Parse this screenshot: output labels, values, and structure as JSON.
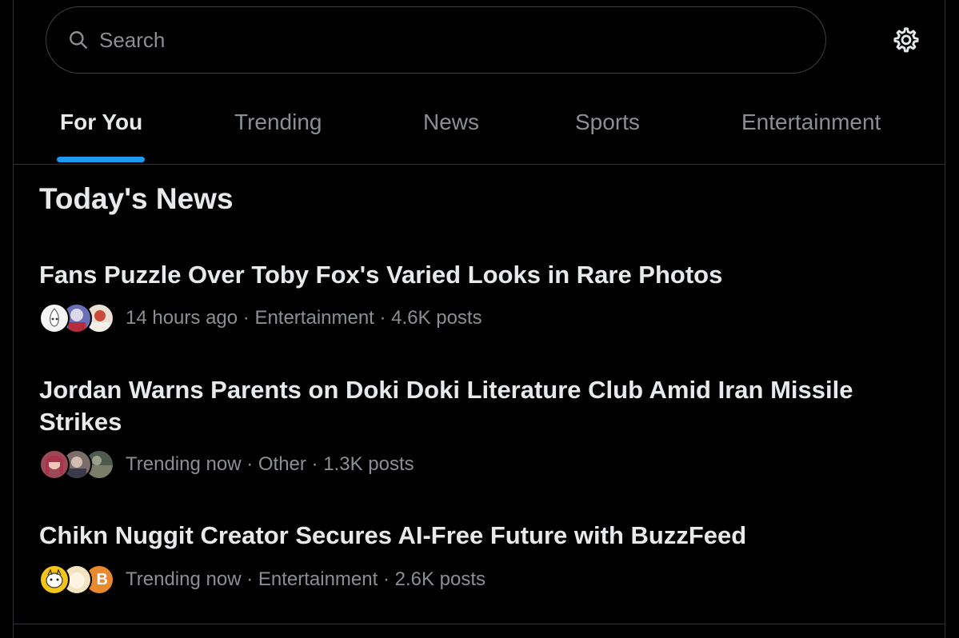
{
  "search": {
    "placeholder": "Search",
    "value": ""
  },
  "tabs": [
    {
      "label": "For You",
      "active": true
    },
    {
      "label": "Trending",
      "active": false
    },
    {
      "label": "News",
      "active": false
    },
    {
      "label": "Sports",
      "active": false
    },
    {
      "label": "Entertainment",
      "active": false
    }
  ],
  "section": {
    "title": "Today's News"
  },
  "news": [
    {
      "headline": "Fans Puzzle Over Toby Fox's Varied Looks in Rare Photos",
      "meta": "14 hours ago · Entertainment · 4.6K posts"
    },
    {
      "headline": "Jordan Warns Parents on Doki Doki Literature Club Amid Iran Missile Strikes",
      "meta": "Trending now · Other · 1.3K posts"
    },
    {
      "headline": "Chikn Nuggit Creator Secures AI-Free Future with BuzzFeed",
      "meta": "Trending now · Entertainment · 2.6K posts",
      "avatar_badge": "B"
    }
  ],
  "icons": {
    "search": "search-icon",
    "settings": "gear-icon"
  },
  "colors": {
    "background": "#000000",
    "text_primary": "#e7e9ea",
    "text_secondary": "#8b8f93",
    "accent": "#1d9bf0",
    "border": "#2f3336"
  }
}
